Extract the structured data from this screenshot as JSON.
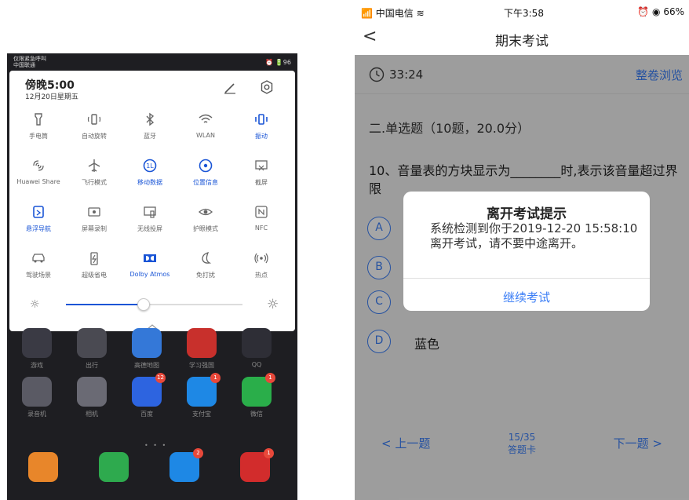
{
  "left": {
    "status": {
      "carrier_line1": "仅限紧急呼叫",
      "carrier_line2": "中国联通",
      "right": "⏰ 🔋96"
    },
    "qs": {
      "time": "傍晚5:00",
      "date": "12月20日星期五",
      "tiles": [
        {
          "label": "手电筒",
          "icon": "flashlight-icon",
          "active": false
        },
        {
          "label": "自动旋转",
          "icon": "rotate-icon",
          "active": false
        },
        {
          "label": "蓝牙",
          "icon": "bluetooth-icon",
          "active": false
        },
        {
          "label": "WLAN",
          "icon": "wifi-icon",
          "active": false
        },
        {
          "label": "振动",
          "icon": "vibrate-icon",
          "active": true
        },
        {
          "label": "Huawei Share",
          "icon": "share-icon",
          "active": false
        },
        {
          "label": "飞行模式",
          "icon": "airplane-icon",
          "active": false
        },
        {
          "label": "移动数据",
          "icon": "mobile-data-icon",
          "active": true
        },
        {
          "label": "位置信息",
          "icon": "location-icon",
          "active": true
        },
        {
          "label": "截屏",
          "icon": "screenshot-icon",
          "active": false
        },
        {
          "label": "悬浮导航",
          "icon": "float-nav-icon",
          "active": true
        },
        {
          "label": "屏幕录制",
          "icon": "screen-record-icon",
          "active": false
        },
        {
          "label": "无线投屏",
          "icon": "cast-icon",
          "active": false
        },
        {
          "label": "护眼模式",
          "icon": "eye-icon",
          "active": false
        },
        {
          "label": "NFC",
          "icon": "nfc-icon",
          "active": false
        },
        {
          "label": "驾驶场景",
          "icon": "car-icon",
          "active": false
        },
        {
          "label": "超级省电",
          "icon": "battery-saver-icon",
          "active": false
        },
        {
          "label": "Dolby Atmos",
          "icon": "dolby-icon",
          "active": true
        },
        {
          "label": "免打扰",
          "icon": "moon-icon",
          "active": false
        },
        {
          "label": "热点",
          "icon": "hotspot-icon",
          "active": false
        }
      ],
      "brightness": 0.44
    },
    "apps_row1": [
      {
        "label": "游戏",
        "color": "#3a3a44",
        "badge": ""
      },
      {
        "label": "出行",
        "color": "#4a4a52",
        "badge": ""
      },
      {
        "label": "高德地图",
        "color": "#3478d8",
        "badge": ""
      },
      {
        "label": "学习强国",
        "color": "#c8302c",
        "badge": ""
      },
      {
        "label": "QQ",
        "color": "#2e2e36",
        "badge": ""
      }
    ],
    "apps_row2": [
      {
        "label": "录音机",
        "color": "#5a5a64",
        "badge": ""
      },
      {
        "label": "相机",
        "color": "#6a6a74",
        "badge": ""
      },
      {
        "label": "百度",
        "color": "#2d64e0",
        "badge": "12"
      },
      {
        "label": "支付宝",
        "color": "#1e88e5",
        "badge": "1"
      },
      {
        "label": "微信",
        "color": "#2aae4a",
        "badge": "1"
      }
    ],
    "dock": [
      {
        "label": "",
        "color": "#e8862a",
        "badge": ""
      },
      {
        "label": "",
        "color": "#2eaa4e",
        "badge": ""
      },
      {
        "label": "",
        "color": "#1e88e5",
        "badge": "2"
      },
      {
        "label": "",
        "color": "#d22c2c",
        "badge": "1"
      }
    ]
  },
  "right": {
    "status": {
      "signal": "📶 中国电信 ≋",
      "time": "下午3:58",
      "right": "⏰ ◉ 66%"
    },
    "nav": {
      "back": "<",
      "title": "期末考试"
    },
    "timer": "33:24",
    "browse": "整卷浏览",
    "section": "二.单选题（10题，20.0分）",
    "question": "10、音量表的方块显示为________时,表示该音量超过界限",
    "options": [
      {
        "letter": "A",
        "text": ""
      },
      {
        "letter": "B",
        "text": ""
      },
      {
        "letter": "C",
        "text": ""
      },
      {
        "letter": "D",
        "text": "蓝色"
      }
    ],
    "dialog": {
      "title": "离开考试提示",
      "message": "系统检测到你于2019-12-20 15:58:10离开考试，请不要中途离开。",
      "button": "继续考试"
    },
    "footer": {
      "prev": "< 上一题",
      "page": "15/35",
      "card": "答题卡",
      "next": "下一题 >"
    }
  }
}
